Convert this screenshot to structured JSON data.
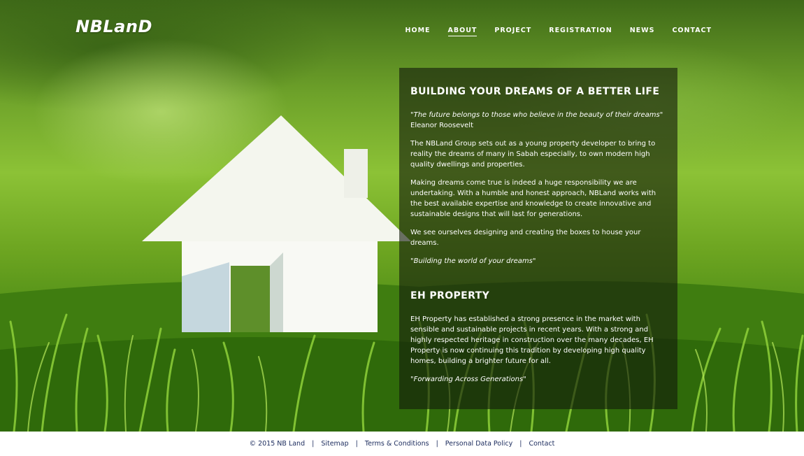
{
  "brand": {
    "logo_text": "NBLanD"
  },
  "nav": {
    "items": [
      {
        "label": "HOME",
        "active": false
      },
      {
        "label": "ABOUT",
        "active": true
      },
      {
        "label": "PROJECT",
        "active": false
      },
      {
        "label": "REGISTRATION",
        "active": false
      },
      {
        "label": "NEWS",
        "active": false
      },
      {
        "label": "CONTACT",
        "active": false
      }
    ]
  },
  "panel": {
    "heading1": "BUILDING YOUR DREAMS OF A BETTER LIFE",
    "quote": "\"The future belongs to those who believe in the beauty of their dreams\"",
    "quote_author": "Eleanor Roosevelt",
    "para1": "The NBLand Group sets out as a young property developer to bring to reality the dreams of many in Sabah especially, to own modern high quality dwellings and properties.",
    "para2": "Making dreams come true is indeed a huge responsibility we are undertaking. With a humble and honest approach, NBLand works with the best available expertise and knowledge to create innovative and sustainable designs that will last for generations.",
    "para3": "We see ourselves designing and creating the boxes to house your dreams.",
    "tagline1": "\"Building the world of your dreams\"",
    "heading2": "EH PROPERTY",
    "para4": "EH Property has established a strong presence in the market with sensible and sustainable projects in recent years. With a strong and highly respected heritage in construction over the many decades, EH Property is now continuing this tradition by developing high quality homes, building a brighter future for all.",
    "tagline2": "\"Forwarding Across Generations\""
  },
  "footer": {
    "copyright": "© 2015 NB Land",
    "separator": "|",
    "links": [
      "Sitemap",
      "Terms & Conditions",
      "Personal Data Policy",
      "Contact"
    ]
  },
  "colors": {
    "panel_bg": "#141c0c",
    "footer_text": "#1a2a5c",
    "grass": "#6da521"
  }
}
